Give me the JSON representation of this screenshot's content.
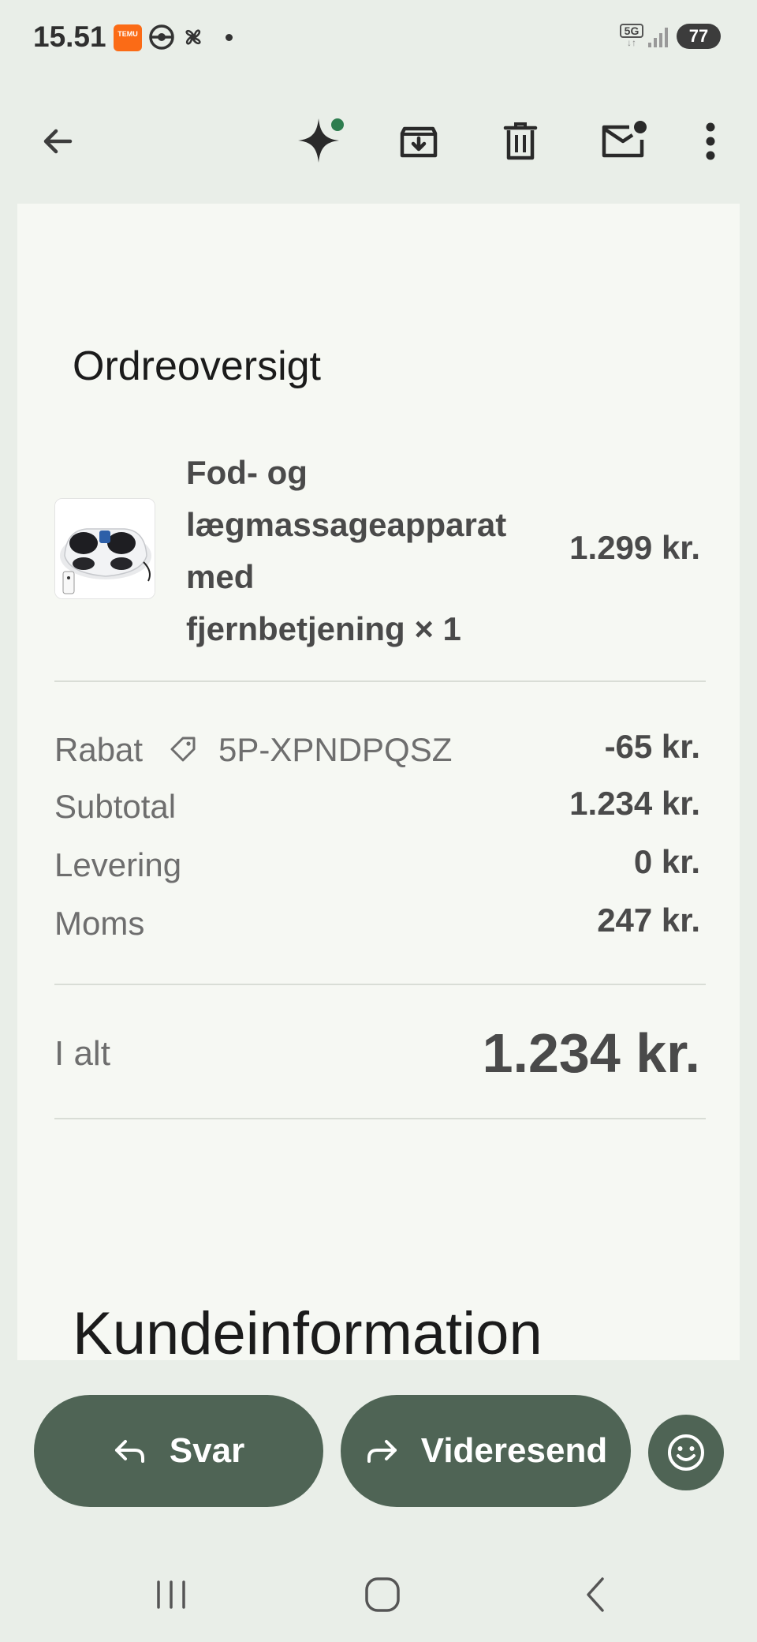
{
  "status_bar": {
    "time": "15.51",
    "temu_badge": "TEMU",
    "network": "5G",
    "network_arrows": "↓↑",
    "battery": "77"
  },
  "toolbar": {
    "icons": [
      "back-arrow-icon",
      "gemini-sparkle-icon",
      "archive-icon",
      "delete-icon",
      "mark-unread-icon",
      "more-icon"
    ]
  },
  "order": {
    "title": "Ordreoversigt",
    "item": {
      "name_lines": [
        "Fod- og",
        "lægmassageapparat",
        "med",
        "fjernbetjening × 1"
      ],
      "price": "1.299 kr."
    },
    "discount_label": "Rabat",
    "discount_code": "5P-XPNDPQSZ",
    "discount_value": "-65 kr.",
    "subtotal_label": "Subtotal",
    "subtotal_value": "1.234 kr.",
    "delivery_label": "Levering",
    "delivery_value": "0 kr.",
    "vat_label": "Moms",
    "vat_value": "247 kr.",
    "total_label": "I alt",
    "total_value": "1.234 kr."
  },
  "customer": {
    "title": "Kundeinformation"
  },
  "actions": {
    "reply_label": "Svar",
    "forward_label": "Videresend"
  },
  "colors": {
    "action_green": "#4f6455",
    "card_bg": "#f6f8f3",
    "screen_bg": "#e9eee8",
    "sparkle_dot": "#2e7d4f"
  }
}
